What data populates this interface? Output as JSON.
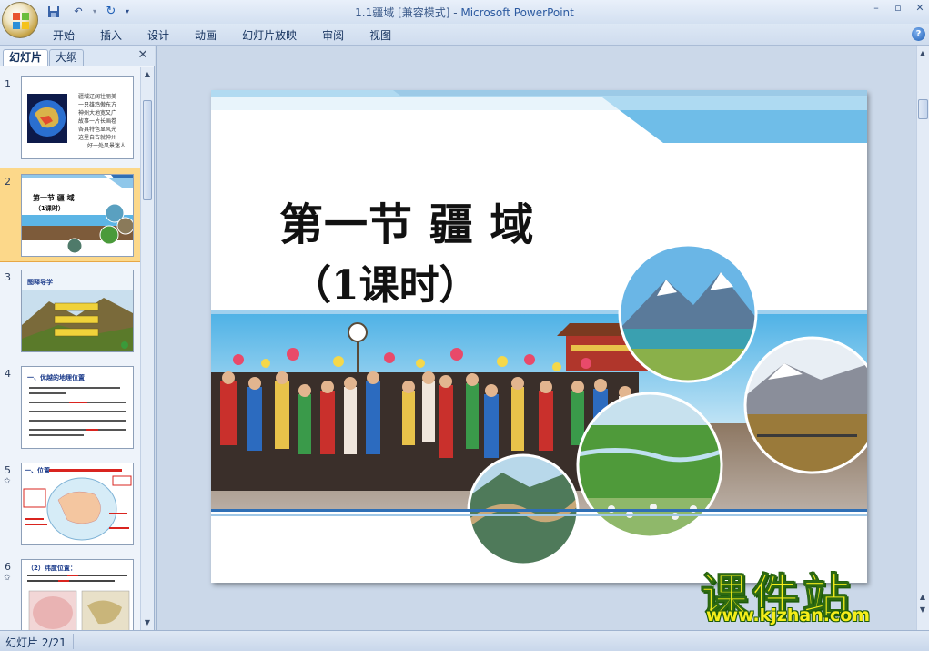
{
  "window": {
    "title_doc": "1.1疆域 [兼容模式] - ",
    "title_app": "Microsoft PowerPoint"
  },
  "ribbon": {
    "tabs": [
      "开始",
      "插入",
      "设计",
      "动画",
      "幻灯片放映",
      "审阅",
      "视图"
    ]
  },
  "left_pane": {
    "tabs": [
      "幻灯片",
      "大纲"
    ],
    "slides": [
      {
        "num": "1",
        "lines": [
          "疆域辽阔壮丽美",
          "一只雄鸡傲东方",
          "神州大地宽又广",
          "故事一片长画卷",
          "各具特色显风光",
          "这里自古就神州",
          "好一处风景迷人"
        ]
      },
      {
        "num": "2",
        "title": "第一节  疆  域",
        "sub": "（1课时）"
      },
      {
        "num": "3",
        "title": "图释导学"
      },
      {
        "num": "4",
        "title": "一、优越的地理位置"
      },
      {
        "num": "5",
        "title": "一、位置"
      },
      {
        "num": "6",
        "title": "（2）纬度位置："
      }
    ]
  },
  "slide": {
    "title": "第一节  疆  域",
    "subtitle": "（1课时）"
  },
  "status": {
    "slide_counter": "幻灯片 2/21"
  },
  "watermark": {
    "text": "课件站",
    "url": "www.kjzhan.com"
  },
  "colors": {
    "accent_blue": "#2f6fb5",
    "selection": "#fcd88a"
  }
}
